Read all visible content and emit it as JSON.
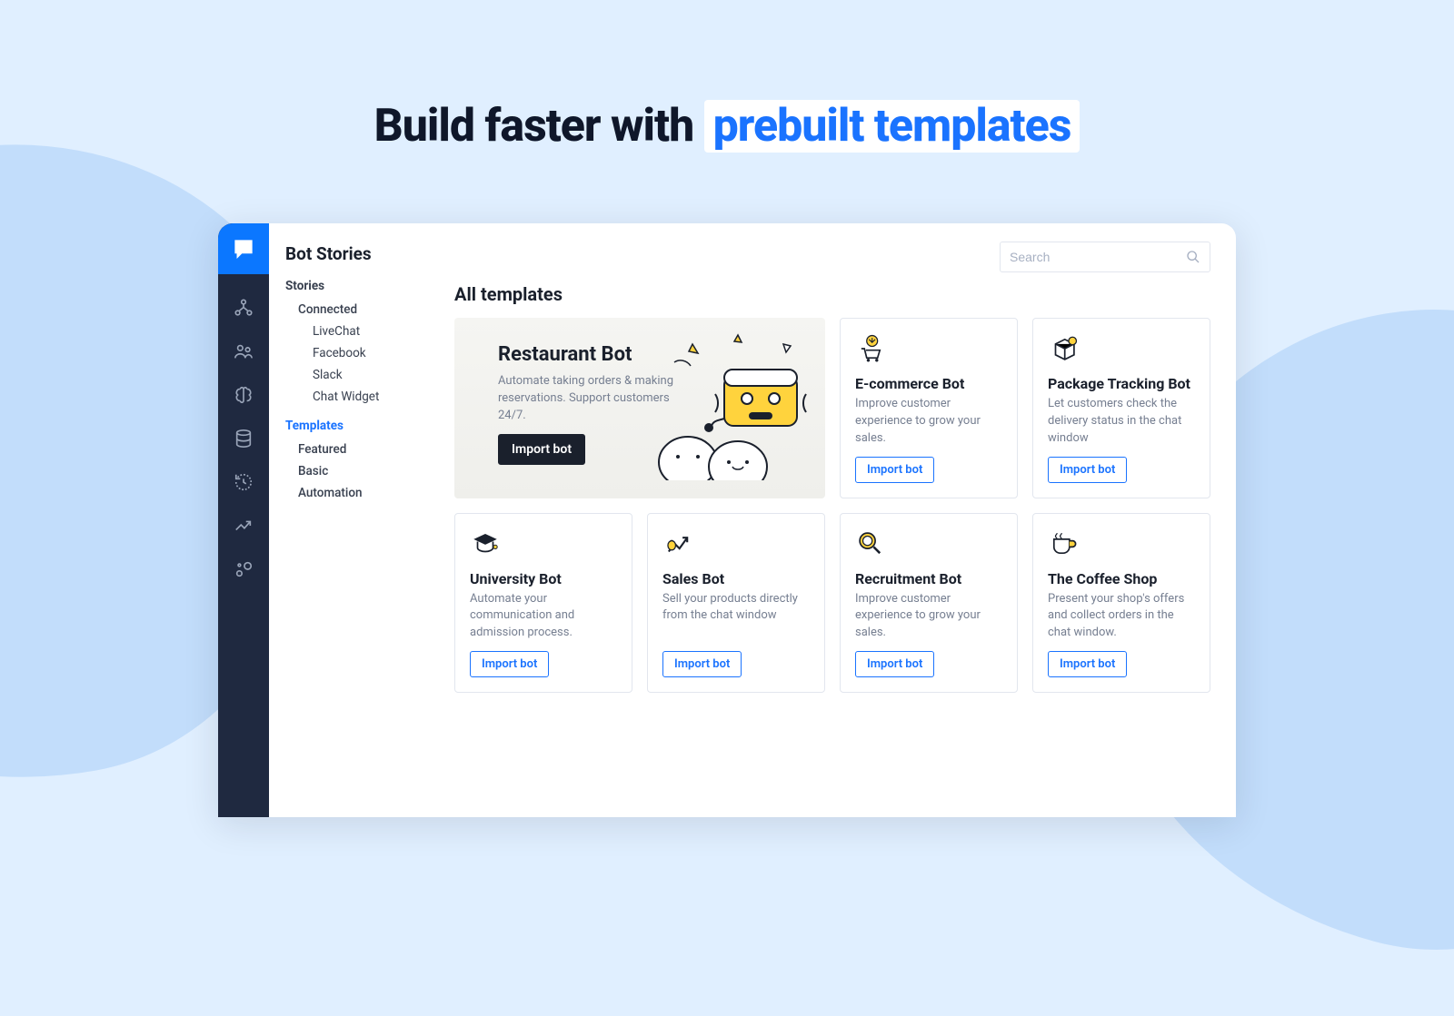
{
  "hero": {
    "prefix": "Build faster with ",
    "highlight": "prebuilt templates"
  },
  "app_title": "Bot Stories",
  "search": {
    "placeholder": "Search"
  },
  "tree": {
    "stories_label": "Stories",
    "stories": [
      {
        "label": "Connected"
      },
      {
        "label": "LiveChat",
        "sub": true
      },
      {
        "label": "Facebook",
        "sub": true
      },
      {
        "label": "Slack",
        "sub": true
      },
      {
        "label": "Chat Widget",
        "sub": true
      }
    ],
    "templates_label": "Templates",
    "templates": [
      {
        "label": "Featured"
      },
      {
        "label": "Basic"
      },
      {
        "label": "Automation"
      }
    ]
  },
  "section_title": "All templates",
  "featured": {
    "title": "Restaurant Bot",
    "desc": "Automate taking orders & making reservations. Support customers 24/7.",
    "cta": "Import bot"
  },
  "cards": [
    {
      "icon": "cart",
      "title": "E-commerce Bot",
      "desc": "Improve customer experience to grow your sales.",
      "cta": "Import bot"
    },
    {
      "icon": "box",
      "title": "Package Tracking Bot",
      "desc": "Let customers check the delivery status in the chat window",
      "cta": "Import bot"
    },
    {
      "icon": "grad",
      "title": "University Bot",
      "desc": "Automate your communication and admission process.",
      "cta": "Import bot"
    },
    {
      "icon": "sales",
      "title": "Sales Bot",
      "desc": "Sell your products directly from the chat window",
      "cta": "Import bot"
    },
    {
      "icon": "search",
      "title": "Recruitment Bot",
      "desc": "Improve customer experience to grow your sales.",
      "cta": "Import bot"
    },
    {
      "icon": "coffee",
      "title": "The Coffee Shop",
      "desc": "Present your shop's offers and collect orders in the chat window.",
      "cta": "Import bot"
    }
  ]
}
